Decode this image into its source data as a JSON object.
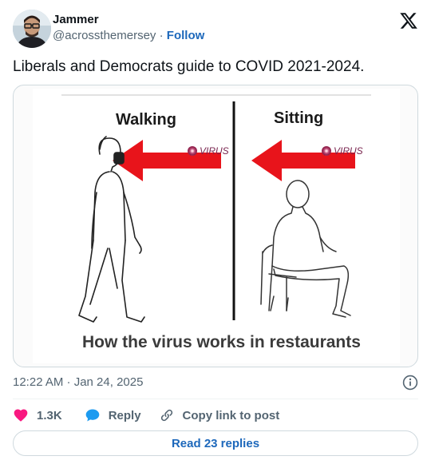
{
  "author": {
    "display_name": "Jammer",
    "handle": "@acrossthemersey",
    "separator": "·",
    "follow_label": "Follow"
  },
  "tweet": {
    "text": "Liberals and Democrats guide to COVID 2021-2024.",
    "timestamp": "12:22 AM · Jan 24, 2025"
  },
  "media": {
    "left_title": "Walking",
    "right_title": "Sitting",
    "virus_label": "VIRUS",
    "caption": "How the virus works in restaurants"
  },
  "actions": {
    "like_count": "1.3K",
    "reply_label": "Reply",
    "copy_label": "Copy link to post"
  },
  "read_replies_label": "Read 23 replies",
  "colors": {
    "link_blue": "#1d68bb",
    "like_pink": "#f91880",
    "secondary_text": "#536471",
    "arrow_red": "#e8141b"
  },
  "icons": {
    "platform": "x-logo-icon",
    "info": "info-icon",
    "like": "heart-icon",
    "reply": "speech-bubble-icon",
    "copy": "link-icon"
  }
}
